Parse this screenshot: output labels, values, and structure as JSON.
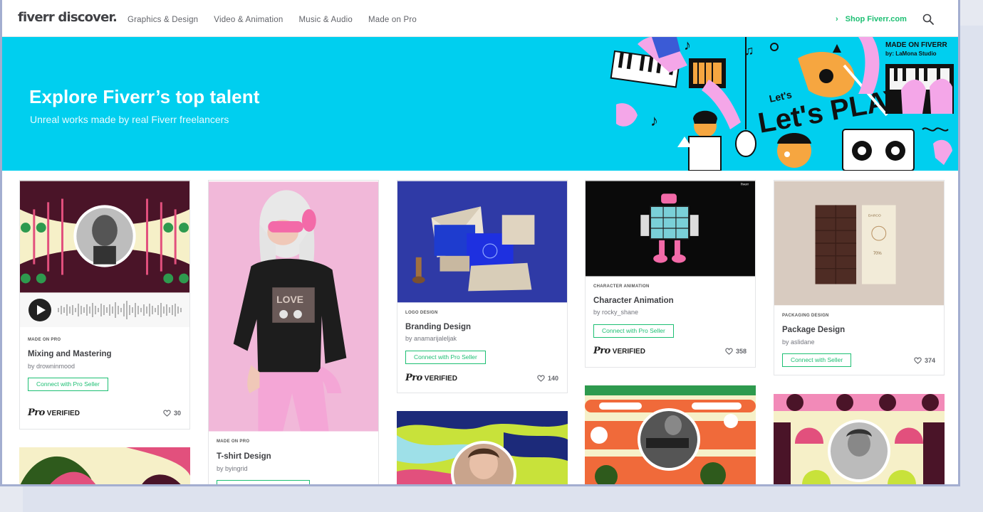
{
  "header": {
    "logo": "fiverr discover.",
    "nav": [
      "Graphics & Design",
      "Video & Animation",
      "Music & Audio",
      "Made on Pro"
    ],
    "shop_label": "Shop Fiverr.com",
    "shop_icon": "chevron-right-icon",
    "search_icon": "search-icon"
  },
  "hero": {
    "title": "Explore Fiverr’s top talent",
    "subtitle": "Unreal works made by real Fiverr freelancers",
    "badge_title": "MADE ON FIVERR",
    "badge_sub": "by: LaMona Studio",
    "art_text": "Let's PLAY!"
  },
  "cards": [
    {
      "category": "MADE ON PRO",
      "title": "Mixing and Mastering",
      "by": "by drowninmood",
      "cta": "Connect with Pro Seller",
      "verified": "VERIFIED",
      "likes": "30"
    },
    {
      "category": "MADE ON PRO",
      "title": "T-shirt Design",
      "by": "by byingrid",
      "cta": ""
    },
    {
      "category": "LOGO DESIGN",
      "title": "Branding Design",
      "by": "by anamarijaleljak",
      "cta": "Connect with Pro Seller",
      "verified": "VERIFIED",
      "likes": "140"
    },
    {
      "category": "CHARACTER ANIMATION",
      "title": "Character Animation",
      "by": "by rocky_shane",
      "cta": "Connect with Pro Seller",
      "verified": "VERIFIED",
      "likes": "358"
    },
    {
      "category": "PACKAGING DESIGN",
      "title": "Package Design",
      "by": "by aslidane",
      "cta": "Connect with Seller",
      "likes": "374"
    }
  ],
  "pro_mark": "Pro",
  "colors": {
    "accent": "#1dbf73",
    "hero": "#00cfef",
    "text": "#404145"
  }
}
